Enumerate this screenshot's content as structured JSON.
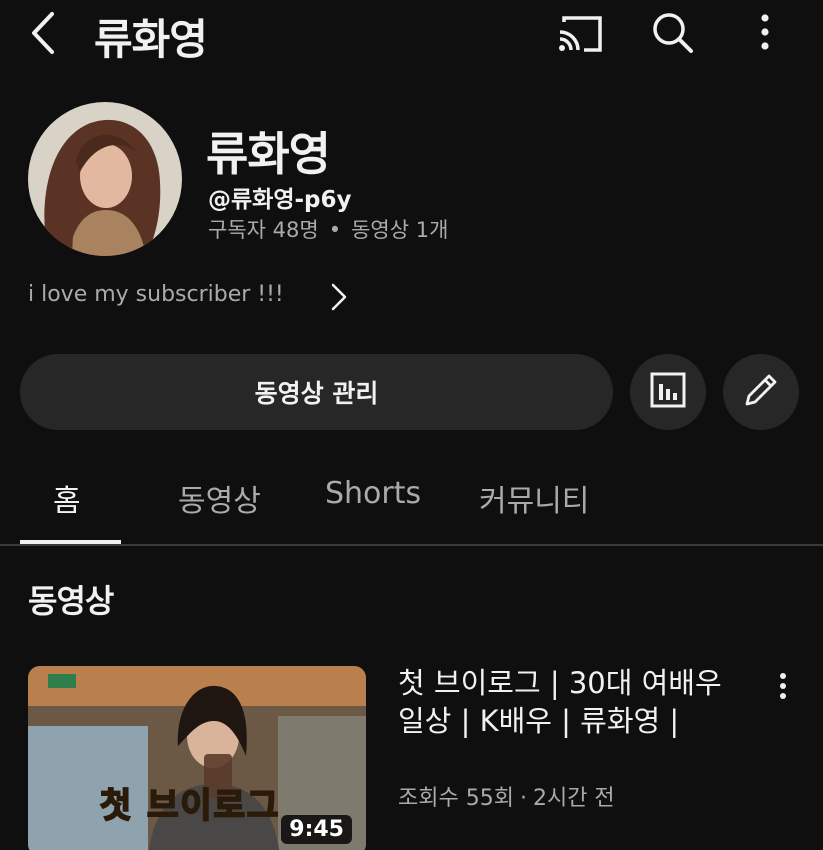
{
  "header": {
    "title": "류화영",
    "icons": [
      "back-arrow-icon",
      "cast-icon",
      "search-icon",
      "more-vert-icon"
    ]
  },
  "channel": {
    "name": "류화영",
    "handle": "@류화영-p6y",
    "subscribers": "구독자 48명",
    "separator": "•",
    "videos": "동영상 1개",
    "description": "i love my subscriber !!!"
  },
  "actions": {
    "manage_label": "동영상 관리",
    "icons": [
      "analytics-icon",
      "edit-pencil-icon"
    ]
  },
  "tabs": [
    {
      "label": "홈",
      "active": true
    },
    {
      "label": "동영상",
      "active": false
    },
    {
      "label": "Shorts",
      "active": false
    },
    {
      "label": "커뮤니티",
      "active": false
    }
  ],
  "section": {
    "title": "동영상"
  },
  "video": {
    "title": "첫 브이로그 | 30대 여배우 일상 | K배우 | 류화영 |",
    "views": "조회수 55회",
    "separator": "·",
    "time": "2시간 전",
    "duration": "9:45",
    "overlay_text": "첫 브이로그"
  },
  "colors": {
    "background": "#0f0f0f",
    "button": "#272727",
    "secondary_text": "#aaaaaa",
    "primary_text": "#f1f1f1"
  }
}
